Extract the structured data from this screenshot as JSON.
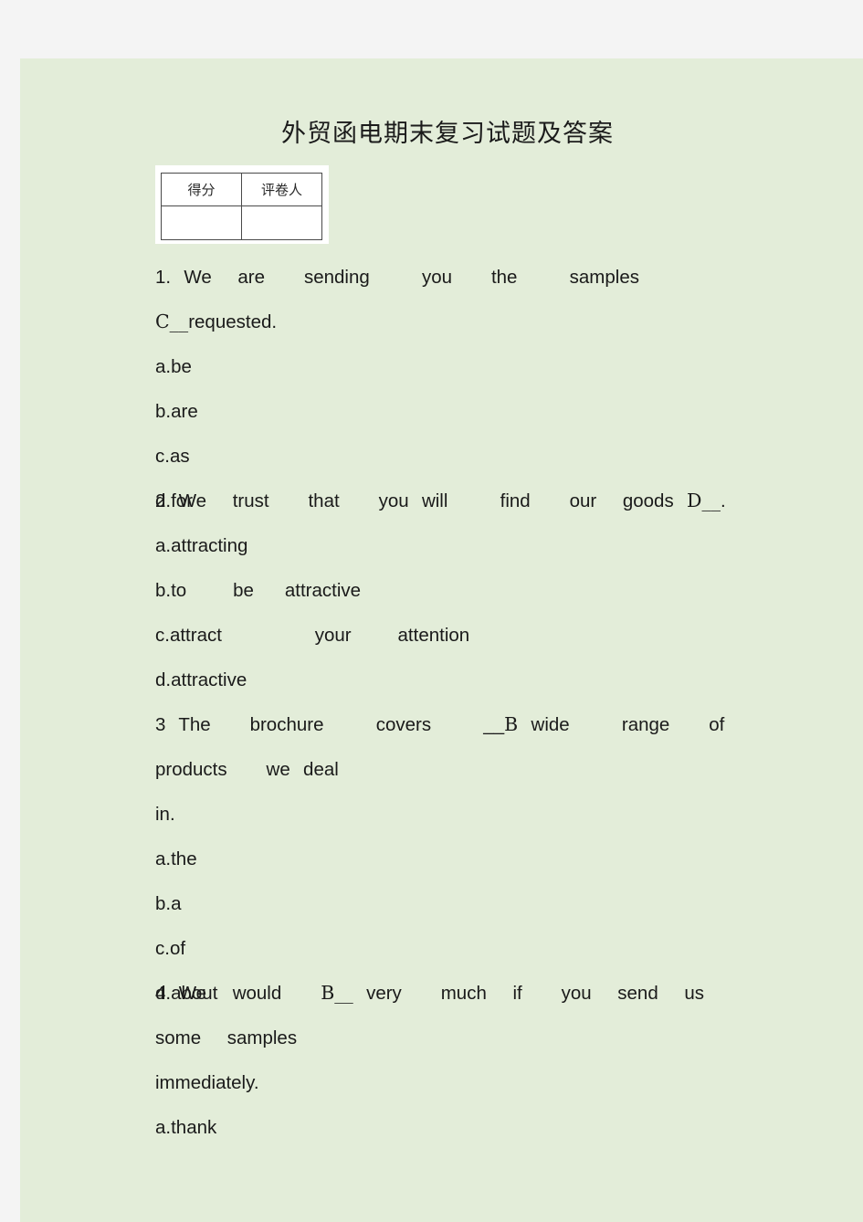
{
  "document": {
    "title": "外贸函电期末复习试题及答案",
    "page_background": "#e3edd9",
    "outer_background": "#f4f4f4",
    "text_color": "#1a1a1a"
  },
  "score_table": {
    "headers": [
      "得分",
      "评卷人"
    ],
    "values": [
      "",
      ""
    ]
  },
  "questions": [
    {
      "number": "1.",
      "stem_before": "1. We  are   sending    you   the    samples   ",
      "answer": "C__",
      "stem_after": "requested.",
      "full_text": "1. We are sending you the samples C__requested.",
      "options": [
        "a.be",
        "b.are",
        "c.as",
        "d.for"
      ]
    },
    {
      "number": "2",
      "stem_before": "2 We  trust   that   you will    find   our  goods ",
      "answer": "D__",
      "stem_after": ".",
      "full_text": "2 We trust that you will find our goods D__.",
      "options": [
        "a.attracting",
        "b.to   be  attractive",
        "c.attract      your   attention",
        "d.attractive"
      ]
    },
    {
      "number": "3",
      "stem_before": "3 The   brochure    covers    __",
      "answer": "B",
      "stem_after": " wide    range   of   products   we deal",
      "stem_line2": "in.",
      "full_text": "3 The brochure covers __B wide range of products we deal in.",
      "options": [
        "a.the",
        "b.a",
        "c.of",
        "d.about"
      ]
    },
    {
      "number": "4",
      "stem_before": "4 We  would   ",
      "answer": "B__",
      "stem_after": " very   much  if   you  send  us  some  samples",
      "stem_line2": "immediately.",
      "full_text": "4 We would B__ very much if you send us some samples immediately.",
      "options": [
        "a.thank"
      ]
    }
  ]
}
